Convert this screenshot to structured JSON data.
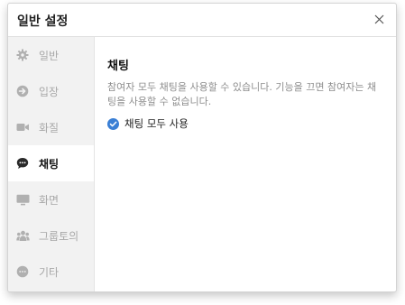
{
  "dialog": {
    "title": "일반 설정",
    "close_icon": "close-icon"
  },
  "sidebar": {
    "items": [
      {
        "label": "일반",
        "icon": "gear-icon",
        "active": false
      },
      {
        "label": "입장",
        "icon": "enter-arrow-icon",
        "active": false
      },
      {
        "label": "화질",
        "icon": "video-camera-icon",
        "active": false
      },
      {
        "label": "채팅",
        "icon": "chat-bubble-icon",
        "active": true
      },
      {
        "label": "화면",
        "icon": "monitor-icon",
        "active": false
      },
      {
        "label": "그룹토의",
        "icon": "group-icon",
        "active": false
      },
      {
        "label": "기타",
        "icon": "more-icon",
        "active": false
      }
    ]
  },
  "content": {
    "title": "채팅",
    "description_line1": "참여자 모두 채팅을 사용할 수 있습니다. 기능을 끄면 참여자는 채",
    "description_line2": "팅을 사용할 수 없습니다.",
    "checkbox_label": "채팅 모두 사용",
    "checkbox_checked": true
  },
  "colors": {
    "accent": "#3a7fd5",
    "sidebar_bg": "#f2f2f2",
    "inactive_text": "#a8a8a8"
  }
}
